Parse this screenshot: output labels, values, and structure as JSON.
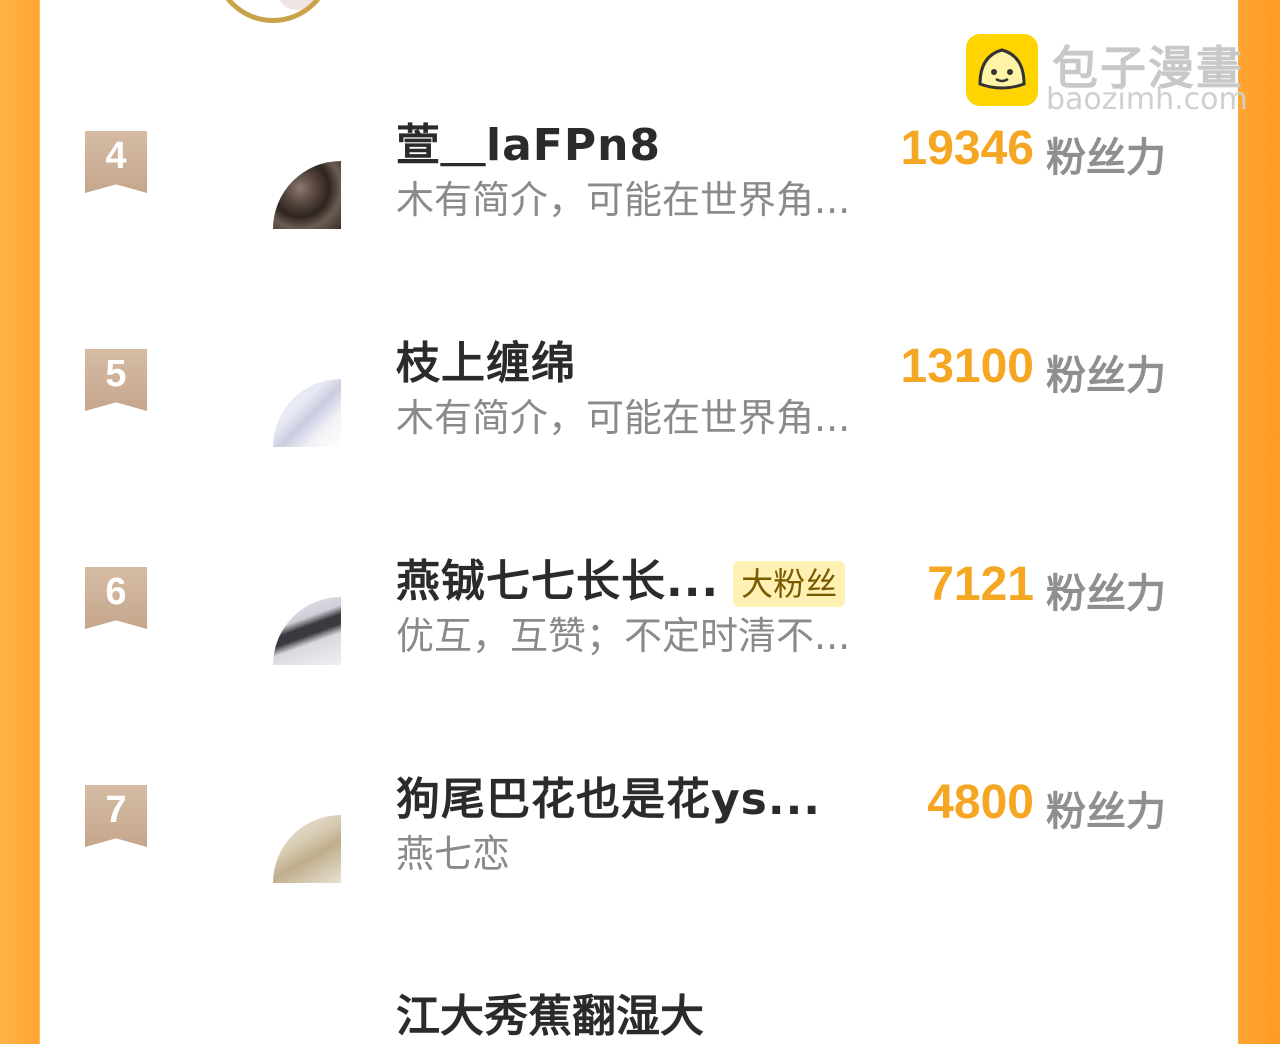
{
  "watermark": {
    "title": "包子漫畫",
    "subtitle": "baozimh.com"
  },
  "unit_label": "粉丝力",
  "ranking": [
    {
      "rank": "4",
      "name": "萱＿laFPn8",
      "badge": "",
      "desc": "木有简介，可能在世界角...",
      "score": "19346"
    },
    {
      "rank": "5",
      "name": "枝上缠绵",
      "badge": "",
      "desc": "木有简介，可能在世界角...",
      "score": "13100"
    },
    {
      "rank": "6",
      "name": "燕铖七七长长...",
      "badge": "大粉丝",
      "desc": "优互，互赞；不定时清不...",
      "score": "7121"
    },
    {
      "rank": "7",
      "name": "狗尾巴花也是花ys...",
      "badge": "",
      "desc": "燕七恋",
      "score": "4800"
    }
  ],
  "partial_next_name": "江大秀蕉翻湿大",
  "colors": {
    "accent": "#f5a623",
    "rank_badge": "#c8aa90",
    "side": "#ffa531"
  }
}
